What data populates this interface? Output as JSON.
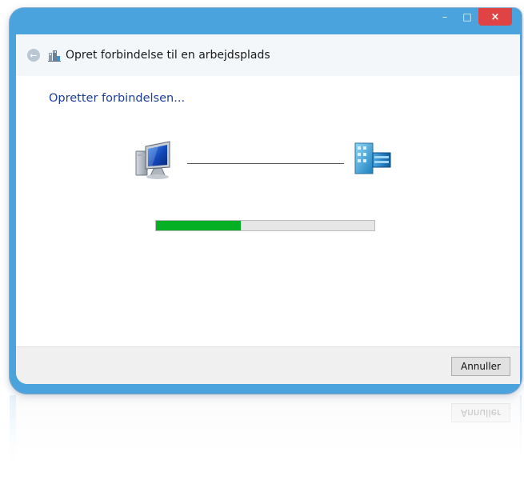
{
  "window": {
    "title": "Opret forbindelse til en arbejdsplads",
    "controls": {
      "minimize": "–",
      "maximize": "□",
      "close": "×"
    }
  },
  "nav": {
    "back_icon": "back-arrow-icon",
    "back_glyph": "←",
    "title_icon": "workplace-network-icon"
  },
  "content": {
    "status_heading": "Opretter forbindelsen...",
    "left_icon": "computer-icon",
    "right_icon": "server-icon",
    "progress_fraction": 0.39
  },
  "footer": {
    "cancel_label": "Annuller"
  },
  "colors": {
    "frame": "#4aa3dc",
    "heading": "#1d3f99",
    "progress_fill": "#06b025",
    "close_button": "#e04343"
  }
}
